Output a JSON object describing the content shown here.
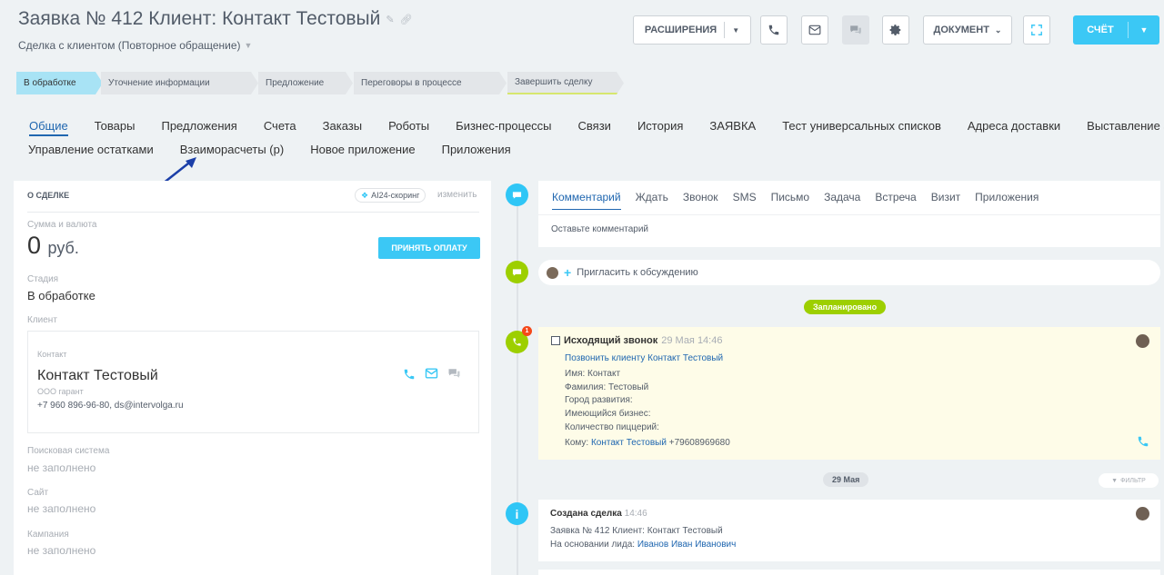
{
  "header": {
    "title": "Заявка № 412 Клиент: Контакт  Тестовый",
    "subtitle": "Сделка с клиентом (Повторное обращение)",
    "buttons": {
      "extensions": "РАСШИРЕНИЯ",
      "document": "ДОКУМЕНТ",
      "bill": "СЧЁТ"
    }
  },
  "stages": [
    "В обработке",
    "Уточнение информации",
    "Предложение",
    "Переговоры в процессе",
    "Завершить сделку"
  ],
  "tabs_row1": [
    "Общие",
    "Товары",
    "Предложения",
    "Счета",
    "Заказы",
    "Роботы",
    "Бизнес-процессы",
    "Связи",
    "История",
    "ЗАЯВКА",
    "Тест универсальных списков",
    "Адреса доставки",
    "Выставление акта"
  ],
  "tabs_row2": [
    "Управление остатками",
    "Взаиморасчеты (р)",
    "Новое приложение",
    "Приложения"
  ],
  "deal": {
    "heading": "О СДЕЛКЕ",
    "ai_badge": "AI24-скоринг",
    "change": "изменить",
    "sum_label": "Сумма и валюта",
    "sum_value": "0",
    "sum_currency": "руб.",
    "pay_button": "ПРИНЯТЬ ОПЛАТУ",
    "stage_label": "Стадия",
    "stage_value": "В обработке",
    "client_label": "Клиент",
    "contact_label": "Контакт",
    "contact_name": "Контакт Тестовый",
    "contact_org": "ООО гарант",
    "contact_info": "+7 960 896-96-80, ds@intervolga.ru",
    "search_label": "Поисковая система",
    "search_value": "не заполнено",
    "site_label": "Сайт",
    "site_value": "не заполнено",
    "campaign_label": "Кампания",
    "campaign_value": "не заполнено"
  },
  "timeline": {
    "comment_tabs": [
      "Комментарий",
      "Ждать",
      "Звонок",
      "SMS",
      "Письмо",
      "Задача",
      "Встреча",
      "Визит",
      "Приложения"
    ],
    "comment_placeholder": "Оставьте комментарий",
    "invite": "Пригласить к обсуждению",
    "planned_label": "Запланировано",
    "badge_count": "1",
    "call": {
      "title": "Исходящий звонок",
      "time": "29 Мая 14:46",
      "link": "Позвонить клиенту Контакт Тестовый",
      "lines": [
        "Имя: Контакт",
        "Фамилия: Тестовый",
        "Город развития:",
        "Имеющийся бизнес:",
        "Количество пиццерий:"
      ],
      "to_label": "Кому:",
      "to_name": "Контакт Тестовый",
      "to_phone": "+79608969680"
    },
    "date_label": "29 Мая",
    "filter": "ФИЛЬТР",
    "created": {
      "title": "Создана сделка",
      "time": "14:46",
      "line1": "Заявка № 412 Клиент: Контакт Тестовый",
      "line2_prefix": "На основании лида:",
      "line2_link": "Иванов Иван Иванович"
    }
  }
}
